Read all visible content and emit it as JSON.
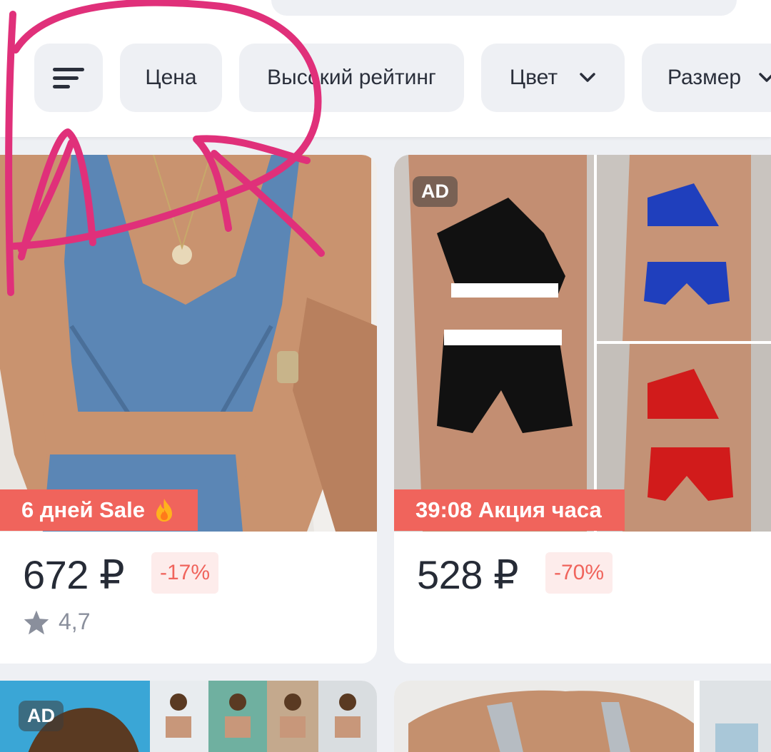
{
  "filters": {
    "sort_icon": "sort-lines-icon",
    "chips": [
      {
        "label": "Цена"
      },
      {
        "label": "Высокий рейтинг"
      },
      {
        "label": "Цвет",
        "icon": "chevron-down-icon"
      },
      {
        "label": "Размер",
        "icon": "chevron-down-icon"
      }
    ]
  },
  "products": [
    {
      "promo": "6 дней Sale",
      "promo_icon": "fire-icon",
      "price": "672 ₽",
      "discount": "-17%",
      "rating": "4,7"
    },
    {
      "ad": "AD",
      "promo": "39:08 Акция часа",
      "price": "528 ₽",
      "discount": "-70%"
    },
    {
      "ad": "AD"
    },
    {}
  ],
  "colors": {
    "accent": "#f0645c",
    "discount_bg": "#fdeceb",
    "chip_bg": "#eef0f4",
    "annotation": "#e0307a"
  }
}
